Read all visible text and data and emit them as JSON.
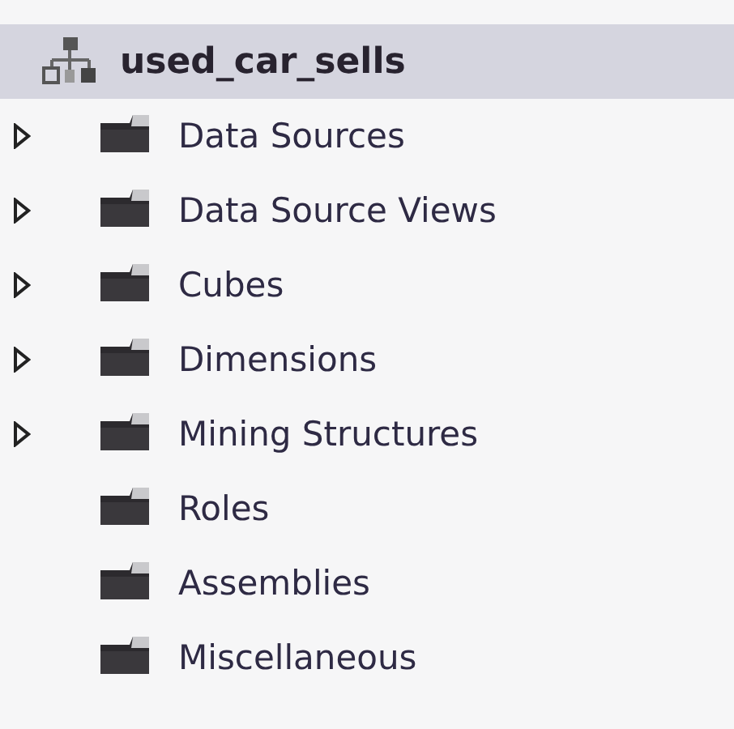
{
  "tree": {
    "root": {
      "label": "used_car_sells",
      "selected": true
    },
    "children": [
      {
        "label": "Data Sources",
        "kind": "expandable"
      },
      {
        "label": "Data Source Views",
        "kind": "expandable"
      },
      {
        "label": "Cubes",
        "kind": "expandable"
      },
      {
        "label": "Dimensions",
        "kind": "expandable"
      },
      {
        "label": "Mining Structures",
        "kind": "expandable"
      },
      {
        "label": "Roles",
        "kind": "leaf"
      },
      {
        "label": "Assemblies",
        "kind": "leaf"
      },
      {
        "label": "Miscellaneous",
        "kind": "leaf"
      }
    ]
  }
}
